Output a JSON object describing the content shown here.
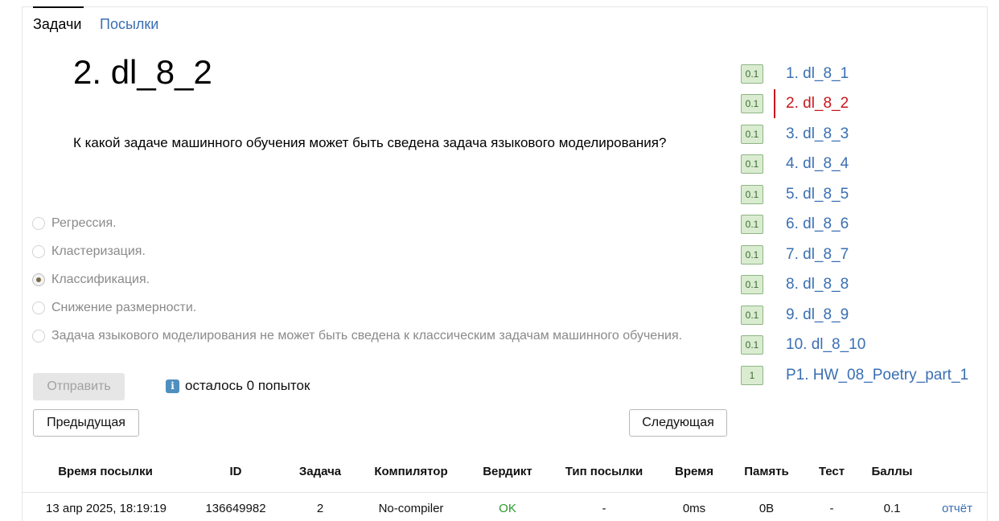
{
  "tabs": {
    "active": "Задачи",
    "other": "Посылки"
  },
  "problem": {
    "title": "2. dl_8_2",
    "statement": "К какой задаче машинного обучения может быть сведена задача языкового моделирования?"
  },
  "options": [
    {
      "label": "Регрессия.",
      "checked": false
    },
    {
      "label": "Кластеризация.",
      "checked": false
    },
    {
      "label": "Классификация.",
      "checked": true
    },
    {
      "label": "Снижение размерности.",
      "checked": false
    },
    {
      "label": "Задача языкового моделирования не может быть сведена к классическим задачам машинного обучения.",
      "checked": false
    }
  ],
  "submit_label": "Отправить",
  "attempts": {
    "icon": "info-icon",
    "text": "осталось 0 попыток"
  },
  "nav": {
    "prev_label": "Предыдущая",
    "next_label": "Следующая"
  },
  "sidebar": {
    "active_index": 1,
    "items": [
      {
        "score": "0.1",
        "label": "1. dl_8_1"
      },
      {
        "score": "0.1",
        "label": "2. dl_8_2"
      },
      {
        "score": "0.1",
        "label": "3. dl_8_3"
      },
      {
        "score": "0.1",
        "label": "4. dl_8_4"
      },
      {
        "score": "0.1",
        "label": "5. dl_8_5"
      },
      {
        "score": "0.1",
        "label": "6. dl_8_6"
      },
      {
        "score": "0.1",
        "label": "7. dl_8_7"
      },
      {
        "score": "0.1",
        "label": "8. dl_8_8"
      },
      {
        "score": "0.1",
        "label": "9. dl_8_9"
      },
      {
        "score": "0.1",
        "label": "10. dl_8_10"
      },
      {
        "score": "1",
        "label": "P1. HW_08_Poetry_part_1"
      }
    ]
  },
  "submissions": {
    "headers": [
      "Время посылки",
      "ID",
      "Задача",
      "Компилятор",
      "Вердикт",
      "Тип посылки",
      "Время",
      "Память",
      "Тест",
      "Баллы"
    ],
    "rows": [
      [
        "13 апр 2025, 18:19:19",
        "136649982",
        "2",
        "No-compiler",
        "OK",
        "-",
        "0ms",
        "0B",
        "-",
        "0.1",
        "отчёт"
      ]
    ]
  },
  "colors": {
    "link": "#3a6fb3",
    "active": "#c8171e",
    "ok": "#2a9b2a",
    "score_bg": "#d9ecd0"
  }
}
